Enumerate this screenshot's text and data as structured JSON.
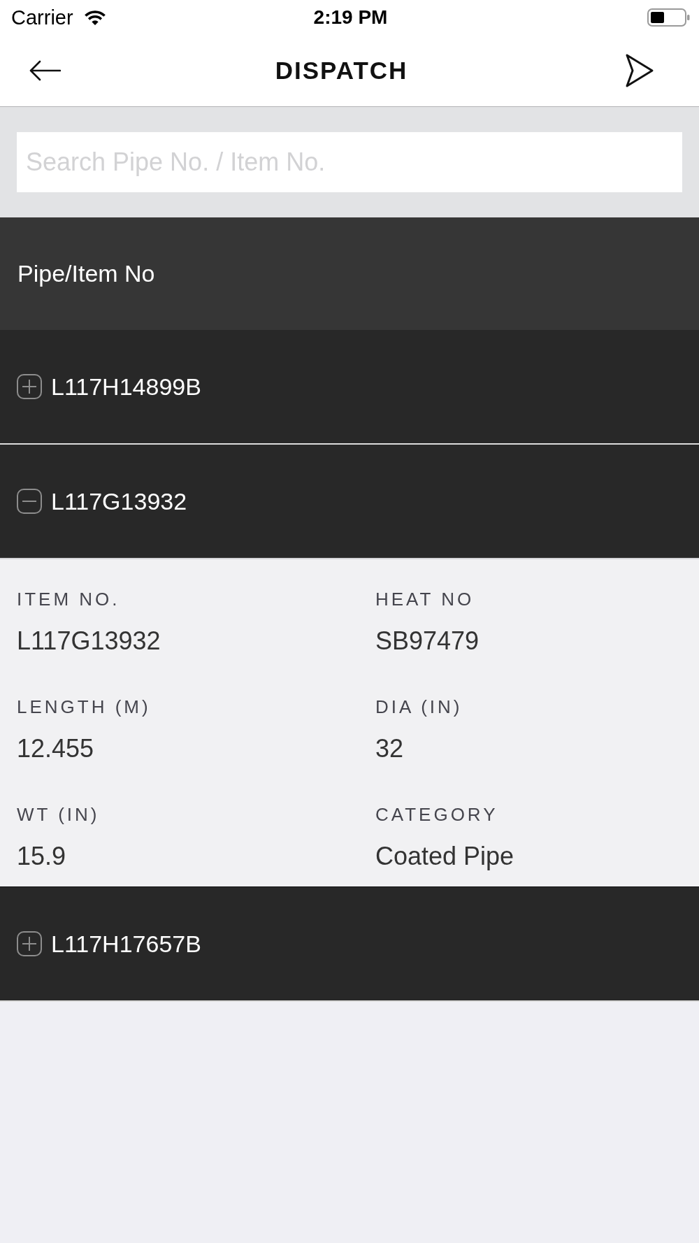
{
  "status_bar": {
    "carrier": "Carrier",
    "time": "2:19 PM"
  },
  "nav_bar": {
    "title": "DISPATCH"
  },
  "search": {
    "placeholder": "Search Pipe No. / Item No."
  },
  "list": {
    "header": "Pipe/Item No",
    "rows": [
      {
        "item_no": "L117H14899B",
        "expanded": false
      },
      {
        "item_no": "L117G13932",
        "expanded": true,
        "details": [
          {
            "label": "ITEM NO.",
            "value": "L117G13932"
          },
          {
            "label": "HEAT NO",
            "value": "SB97479"
          },
          {
            "label": "LENGTH (M)",
            "value": "12.455"
          },
          {
            "label": "DIA (IN)",
            "value": "32"
          },
          {
            "label": "WT (IN)",
            "value": "15.9"
          },
          {
            "label": "CATEGORY",
            "value": "Coated Pipe"
          }
        ]
      },
      {
        "item_no": "L117H17657B",
        "expanded": false
      }
    ]
  }
}
